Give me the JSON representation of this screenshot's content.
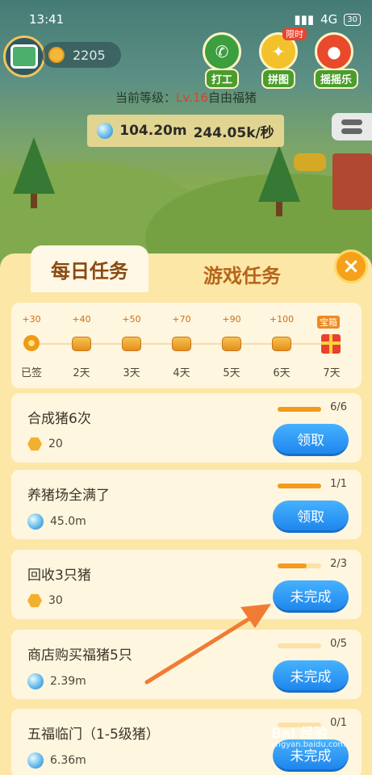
{
  "status_bar": {
    "time": "13:41",
    "network": "4G",
    "battery": "30"
  },
  "player": {
    "coins": "2205"
  },
  "top_buttons": [
    {
      "label": "打工",
      "color": "#3c9e3e"
    },
    {
      "label": "拼图",
      "color": "#f2c12c",
      "badge": "限时"
    },
    {
      "label": "摇摇乐",
      "color": "#e94a2c"
    }
  ],
  "level": {
    "prefix": "当前等级：",
    "level": "Lv.16",
    "name": "自由福猪"
  },
  "production": {
    "total": "104.20m",
    "rate": "244.05k/秒"
  },
  "tabs": {
    "daily": "每日任务",
    "game": "游戏任务",
    "close": "×"
  },
  "sign_in": [
    {
      "reward": "+30",
      "day": "已签",
      "state": "done"
    },
    {
      "reward": "+40",
      "day": "2天"
    },
    {
      "reward": "+50",
      "day": "3天"
    },
    {
      "reward": "+70",
      "day": "4天"
    },
    {
      "reward": "+90",
      "day": "5天"
    },
    {
      "reward": "+100",
      "day": "6天"
    },
    {
      "reward": "宝箱",
      "day": "7天",
      "state": "chest"
    }
  ],
  "tasks": [
    {
      "title": "合成猪6次",
      "reward": "20",
      "reward_type": "coin",
      "progress": "6/6",
      "progress_value": 1.0,
      "action": "领取"
    },
    {
      "title": "养猪场全满了",
      "reward": "45.0m",
      "reward_type": "gem",
      "progress": "1/1",
      "progress_value": 1.0,
      "action": "领取"
    },
    {
      "title": "回收3只猪",
      "reward": "30",
      "reward_type": "coin",
      "progress": "2/3",
      "progress_value": 0.67,
      "action": "未完成"
    },
    {
      "title": "商店购买福猪5只",
      "reward": "2.39m",
      "reward_type": "gem",
      "progress": "0/5",
      "progress_value": 0.0,
      "action": "未完成"
    },
    {
      "title": "五福临门（1-5级猪）",
      "reward": "6.36m",
      "reward_type": "gem",
      "progress": "0/1",
      "progress_value": 0.0,
      "action": "未完成"
    }
  ],
  "watermark": {
    "text": "Bai 经验",
    "sub": "jingyan.baidu.com"
  },
  "colors": {
    "panel": "#fde7a7",
    "card": "#fff6df",
    "button_blue": "#1f86ec",
    "progress": "#f49a1d",
    "arrow": "#f07c33"
  }
}
